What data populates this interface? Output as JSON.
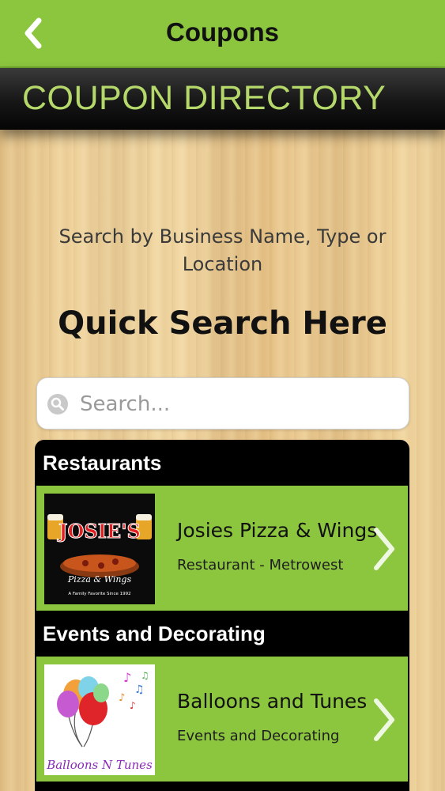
{
  "header": {
    "title": "Coupons",
    "back_icon": "chevron-left-icon"
  },
  "banner": {
    "title": "COUPON DIRECTORY"
  },
  "intro": {
    "text": "Search by Business Name, Type or Location",
    "heading": "Quick Search Here"
  },
  "search": {
    "placeholder": "Search...",
    "value": "",
    "icon": "search-icon"
  },
  "sections": [
    {
      "header": "Restaurants",
      "item": {
        "title": "Josies Pizza & Wings",
        "subtitle": "Restaurant - Metrowest",
        "logo_text": "JOSIE'S",
        "logo_tagline": "Pizza & Wings",
        "logo_footer": "A Family Favorite Since 1992"
      }
    },
    {
      "header": "Events and Decorating",
      "item": {
        "title": "Balloons and Tunes",
        "subtitle": "Events and Decorating",
        "logo_text": "Balloons N Tunes"
      }
    }
  ],
  "colors": {
    "accent_green": "#8cc63f",
    "banner_text": "#b5d86a",
    "list_black": "#000000"
  }
}
